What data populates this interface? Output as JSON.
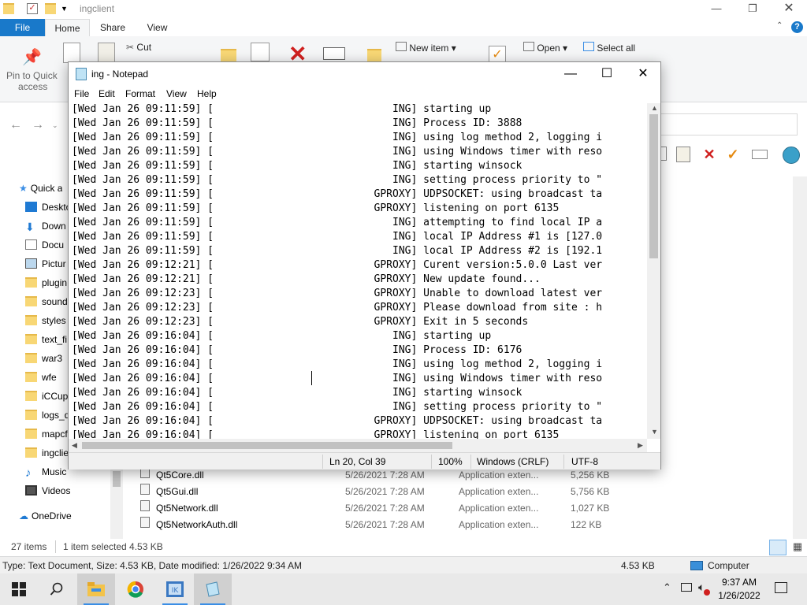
{
  "explorer": {
    "title": "ingclient",
    "tabs": [
      "File",
      "Home",
      "Share",
      "View"
    ],
    "ribbon": {
      "pin_label_1": "Pin to Quick",
      "pin_label_2": "access",
      "cut": "Cut",
      "new_item": "New item ▾",
      "open": "Open ▾",
      "select_all": "Select all"
    },
    "nav_items": [
      "Quick a",
      "Deskto",
      "Down",
      "Docu",
      "Pictur",
      "plugin",
      "sound",
      "styles",
      "text_fi",
      "war3",
      "wfe",
      "iCCup",
      "logs_d",
      "mapcf",
      "ingclie",
      "Music",
      "Videos",
      "OneDrive"
    ],
    "files": [
      {
        "name": "Qt5Core.dll",
        "date": "5/26/2021 7:28 AM",
        "type": "Application exten...",
        "size": "5,256 KB"
      },
      {
        "name": "Qt5Gui.dll",
        "date": "5/26/2021 7:28 AM",
        "type": "Application exten...",
        "size": "5,756 KB"
      },
      {
        "name": "Qt5Network.dll",
        "date": "5/26/2021 7:28 AM",
        "type": "Application exten...",
        "size": "1,027 KB"
      },
      {
        "name": "Qt5NetworkAuth.dll",
        "date": "5/26/2021 7:28 AM",
        "type": "Application exten...",
        "size": "122 KB"
      }
    ],
    "status": {
      "items": "27 items",
      "selected": "1 item selected  4.53 KB"
    },
    "details": {
      "type_info": "Type: Text Document, Size: 4.53 KB, Date modified: 1/26/2022 9:34 AM",
      "size": "4.53 KB",
      "location": "Computer"
    }
  },
  "notepad": {
    "title": "ing - Notepad",
    "menu": [
      "File",
      "Edit",
      "Format",
      "View",
      "Help"
    ],
    "lines": [
      "[Wed Jan 26 09:11:59] [                             ING] starting up",
      "[Wed Jan 26 09:11:59] [                             ING] Process ID: 3888",
      "[Wed Jan 26 09:11:59] [                             ING] using log method 2, logging i",
      "[Wed Jan 26 09:11:59] [                             ING] using Windows timer with reso",
      "[Wed Jan 26 09:11:59] [                             ING] starting winsock",
      "[Wed Jan 26 09:11:59] [                             ING] setting process priority to \"",
      "[Wed Jan 26 09:11:59] [                          GPROXY] UDPSOCKET: using broadcast ta",
      "[Wed Jan 26 09:11:59] [                          GPROXY] listening on port 6135",
      "[Wed Jan 26 09:11:59] [                             ING] attempting to find local IP a",
      "[Wed Jan 26 09:11:59] [                             ING] local IP Address #1 is [127.0",
      "[Wed Jan 26 09:11:59] [                             ING] local IP Address #2 is [192.1",
      "[Wed Jan 26 09:12:21] [                          GPROXY] Curent version:5.0.0 Last ver",
      "[Wed Jan 26 09:12:21] [                          GPROXY] New update found...",
      "[Wed Jan 26 09:12:23] [                          GPROXY] Unable to download latest ver",
      "[Wed Jan 26 09:12:23] [                          GPROXY] Please download from site : h",
      "[Wed Jan 26 09:12:23] [                          GPROXY] Exit in 5 seconds",
      "[Wed Jan 26 09:16:04] [                             ING] starting up",
      "[Wed Jan 26 09:16:04] [                             ING] Process ID: 6176",
      "[Wed Jan 26 09:16:04] [                             ING] using log method 2, logging i",
      "[Wed Jan 26 09:16:04] [                             ING] using Windows timer with reso",
      "[Wed Jan 26 09:16:04] [                             ING] starting winsock",
      "[Wed Jan 26 09:16:04] [                             ING] setting process priority to \"",
      "[Wed Jan 26 09:16:04] [                          GPROXY] UDPSOCKET: using broadcast ta",
      "[Wed Jan 26 09:16:04] [                          GPROXY] listening on port 6135"
    ],
    "status": {
      "position": "Ln 20, Col 39",
      "zoom": "100%",
      "line_ending": "Windows (CRLF)",
      "encoding": "UTF-8"
    }
  },
  "taskbar": {
    "time": "9:37 AM",
    "date": "1/26/2022"
  }
}
